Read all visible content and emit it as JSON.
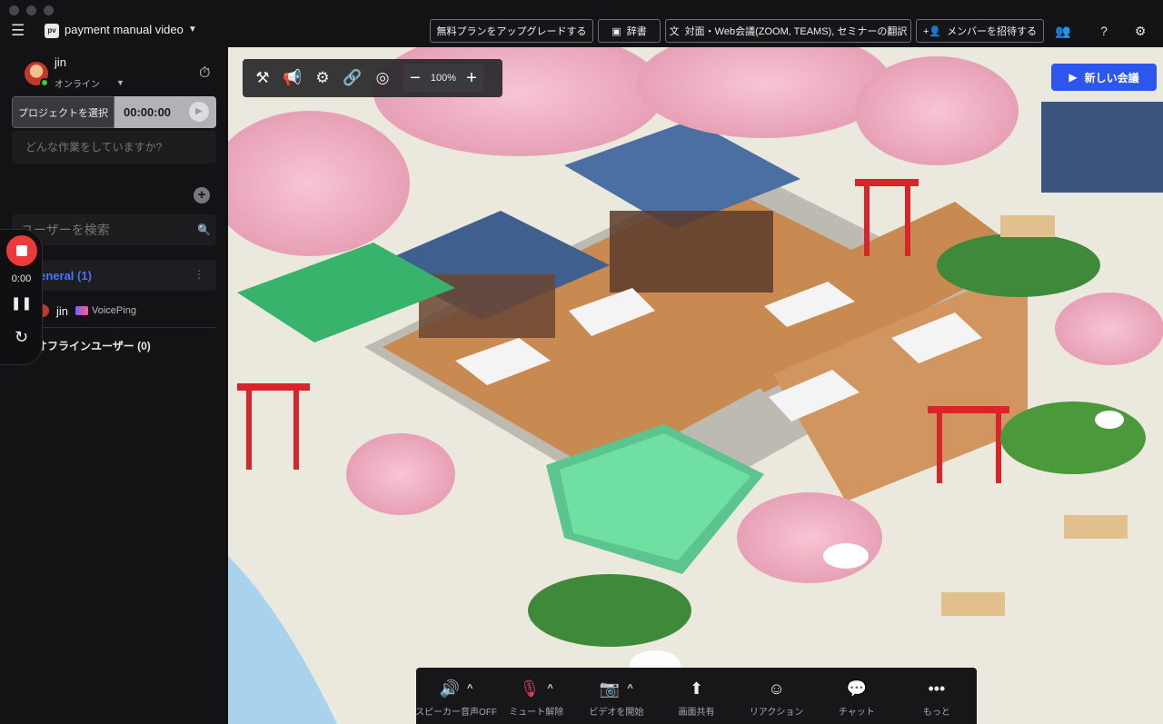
{
  "window": {
    "project_icon": "pv",
    "project_name": "payment manual video"
  },
  "top_bar": {
    "upgrade": "無料プランをアップグレードする",
    "dictionary": "辞書",
    "translate": "対面・Web会議(ZOOM, TEAMS), セミナーの翻訳",
    "invite": "メンバーを招待する"
  },
  "user": {
    "name": "jin",
    "status": "オンライン"
  },
  "project": {
    "select_label": "プロジェクトを選択",
    "timer": "00:00:00"
  },
  "task": {
    "placeholder": "どんな作業をしていますか?"
  },
  "search": {
    "placeholder": "ユーザーを検索"
  },
  "channel": {
    "name": "General (1)"
  },
  "members": [
    {
      "name": "jin",
      "app": "VoicePing"
    }
  ],
  "offline": {
    "label": "オフラインユーザー (0)"
  },
  "recorder": {
    "time": "0:00"
  },
  "toolbar": {
    "zoom": "100%"
  },
  "new_meeting": {
    "label": "新しい会議"
  },
  "callbar": {
    "speaker": "スピーカー音声OFF",
    "mute": "ミュート解除",
    "video": "ビデオを開始",
    "share": "画面共有",
    "reaction": "リアクション",
    "chat": "チャット",
    "more": "もっと"
  },
  "colors": {
    "accent": "#2c56ee",
    "record": "#ec3a3a",
    "muted": "#e23d5e",
    "channel": "#4a74f5"
  }
}
